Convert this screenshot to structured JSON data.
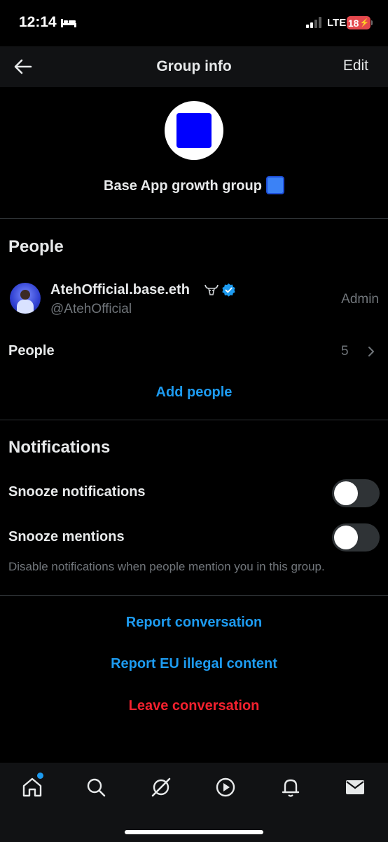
{
  "status_bar": {
    "time": "12:14",
    "network": "LTE",
    "battery": "18"
  },
  "header": {
    "title": "Group info",
    "edit_label": "Edit"
  },
  "group": {
    "name": "Base App growth group"
  },
  "people_section": {
    "title": "People",
    "member": {
      "display_name": "AtehOfficial.base.eth",
      "handle": "@AtehOfficial",
      "role": "Admin"
    },
    "people_row": {
      "label": "People",
      "count": "5"
    },
    "add_people_label": "Add people"
  },
  "notifications_section": {
    "title": "Notifications",
    "snooze_notifications": {
      "label": "Snooze notifications",
      "enabled": false
    },
    "snooze_mentions": {
      "label": "Snooze mentions",
      "enabled": false
    },
    "helper_text": "Disable notifications when people mention you in this group."
  },
  "actions": {
    "report_conversation": "Report conversation",
    "report_eu": "Report EU illegal content",
    "leave_conversation": "Leave conversation"
  },
  "tab_bar": {
    "tabs": [
      {
        "icon": "home-icon",
        "has_badge": true
      },
      {
        "icon": "search-icon"
      },
      {
        "icon": "grok-icon"
      },
      {
        "icon": "video-icon"
      },
      {
        "icon": "bell-icon"
      },
      {
        "icon": "mail-icon",
        "selected": true
      }
    ]
  },
  "colors": {
    "accent": "#1d9bf0",
    "danger": "#f4212e",
    "muted": "#71767b",
    "verified": "#1d9bf0"
  }
}
